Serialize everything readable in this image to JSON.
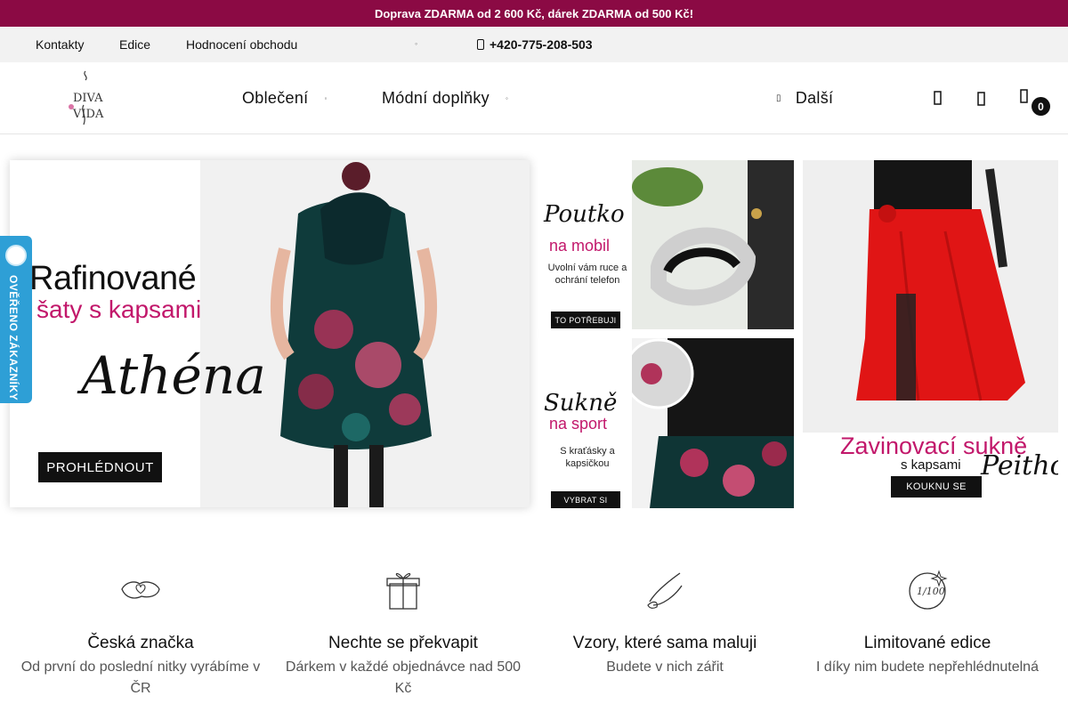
{
  "promo": {
    "text": "Doprava ZDARMA od 2 600 Kč, dárek ZDARMA od 500 Kč!"
  },
  "subnav": {
    "links": [
      "Kontakty",
      "Edice",
      "Hodnocení obchodu"
    ],
    "phone": "+420-775-208-503"
  },
  "header": {
    "logo_text_top": "DIVA",
    "logo_text_bottom": "VIDA",
    "nav": [
      "Oblečení",
      "Módní doplňky",
      "Další"
    ],
    "cart_count": "0"
  },
  "banners": {
    "main": {
      "line1": "Rafinované",
      "line2": "šaty s kapsami",
      "script": "Athéna",
      "button": "PROHLÉDNOUT"
    },
    "phone_strap": {
      "script": "Poutko",
      "sub": "na mobil",
      "text": "Uvolní vám ruce a ochrání telefon",
      "button": "TO POTŘEBUJI"
    },
    "sport_skirt": {
      "script": "Sukně",
      "sub": "na sport",
      "text": "S kraťásky a kapsičkou",
      "button": "VYBRAT SI"
    },
    "wrap_skirt": {
      "title": "Zavinovací sukně",
      "sub": "s kapsami",
      "script": "Peithó",
      "button": "KOUKNU SE"
    }
  },
  "verified_badge": {
    "text": "OVĚŘENO ZÁKAZNÍKY"
  },
  "features": [
    {
      "icon": "czech-map-heart-icon",
      "title": "Česká značka",
      "desc": "Od první do poslední nitky vyrábíme v ČR"
    },
    {
      "icon": "gift-box-icon",
      "title": "Nechte se překvapit",
      "desc": "Dárkem v každé objednávce nad 500 Kč"
    },
    {
      "icon": "brush-pencil-icon",
      "title": "Vzory, které sama maluji",
      "desc": "Budete v nich zářit"
    },
    {
      "icon": "limited-100-icon",
      "title": "Limitované edice",
      "desc": "I díky nim budete nepřehlédnutelná"
    }
  ],
  "colors": {
    "brand": "#8b0a44",
    "accent_pink": "#c2186b",
    "verified_blue": "#2e9fd6"
  }
}
